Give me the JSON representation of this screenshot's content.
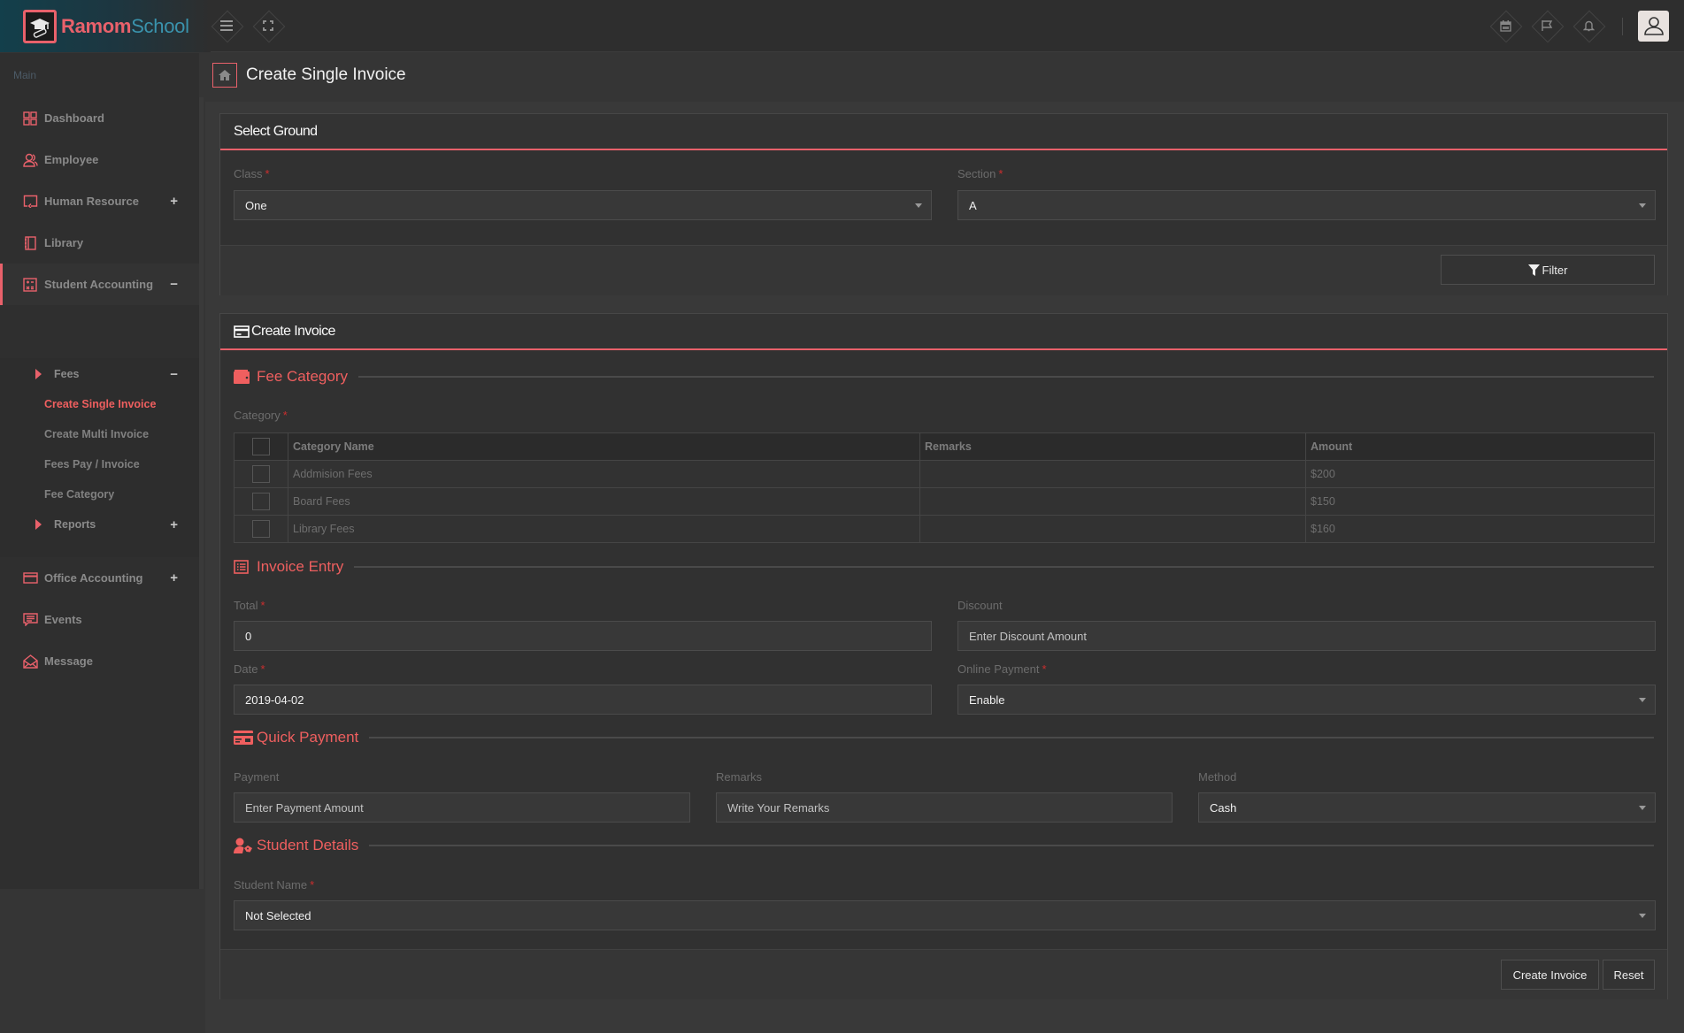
{
  "app": {
    "brand_primary": "Ramom",
    "brand_secondary": "School",
    "accent_color": "#e9616b",
    "brand_blue": "#3a93ad"
  },
  "topbar": {
    "left_buttons": [
      {
        "icon": "menu-icon"
      },
      {
        "icon": "fullscreen-icon"
      }
    ],
    "right_buttons": [
      {
        "icon": "calendar-icon"
      },
      {
        "icon": "flag-icon"
      },
      {
        "icon": "bell-icon"
      }
    ],
    "avatar_icon": "user-icon"
  },
  "sidebar": {
    "heading": "Main",
    "items": [
      {
        "label": "Dashboard",
        "icon": "dashboard-grid-icon",
        "toggle": ""
      },
      {
        "label": "Employee",
        "icon": "users-icon",
        "toggle": ""
      },
      {
        "label": "Human Resource",
        "icon": "screen-share-icon",
        "toggle": "+"
      },
      {
        "label": "Library",
        "icon": "notebook-icon",
        "toggle": ""
      },
      {
        "label": "Student Accounting",
        "icon": "calculator-icon",
        "toggle": "−"
      },
      {
        "label": "Office Accounting",
        "icon": "credit-card-icon",
        "toggle": "+"
      },
      {
        "label": "Events",
        "icon": "comment-icon",
        "toggle": ""
      },
      {
        "label": "Message",
        "icon": "envelope-open-icon",
        "toggle": ""
      }
    ],
    "student_accounting_sub": {
      "fees": {
        "label": "Fees",
        "toggle": "−"
      },
      "fees_links": [
        {
          "label": "Create Single Invoice",
          "current": true
        },
        {
          "label": "Create Multi Invoice",
          "current": false
        },
        {
          "label": "Fees Pay / Invoice",
          "current": false
        },
        {
          "label": "Fee Category",
          "current": false
        }
      ],
      "reports": {
        "label": "Reports",
        "toggle": "+"
      }
    }
  },
  "page": {
    "title": "Create Single Invoice",
    "home_icon": "home-icon"
  },
  "select_ground": {
    "title": "Select Ground",
    "class_label": "Class",
    "class_value": "One",
    "section_label": "Section",
    "section_value": "A",
    "filter_button": "Filter",
    "required_mark": "*"
  },
  "create_invoice": {
    "title": "Create Invoice",
    "fee_category": {
      "title": "Fee Category",
      "category_label": "Category",
      "columns": [
        "Category Name",
        "Remarks",
        "Amount"
      ],
      "rows": [
        {
          "name": "Addmision Fees",
          "remarks": "",
          "amount": "$200"
        },
        {
          "name": "Board Fees",
          "remarks": "",
          "amount": "$150"
        },
        {
          "name": "Library Fees",
          "remarks": "",
          "amount": "$160"
        }
      ]
    },
    "invoice_entry": {
      "title": "Invoice Entry",
      "total_label": "Total",
      "total_value": "0",
      "discount_label": "Discount",
      "discount_placeholder": "Enter Discount Amount",
      "date_label": "Date",
      "date_value": "2019-04-02",
      "online_payment_label": "Online Payment",
      "online_payment_value": "Enable"
    },
    "quick_payment": {
      "title": "Quick Payment",
      "payment_label": "Payment",
      "payment_placeholder": "Enter Payment Amount",
      "remarks_label": "Remarks",
      "remarks_placeholder": "Write Your Remarks",
      "method_label": "Method",
      "method_value": "Cash"
    },
    "student_details": {
      "title": "Student Details",
      "student_name_label": "Student Name",
      "student_name_value": "Not Selected"
    },
    "create_button": "Create Invoice",
    "reset_button": "Reset"
  }
}
